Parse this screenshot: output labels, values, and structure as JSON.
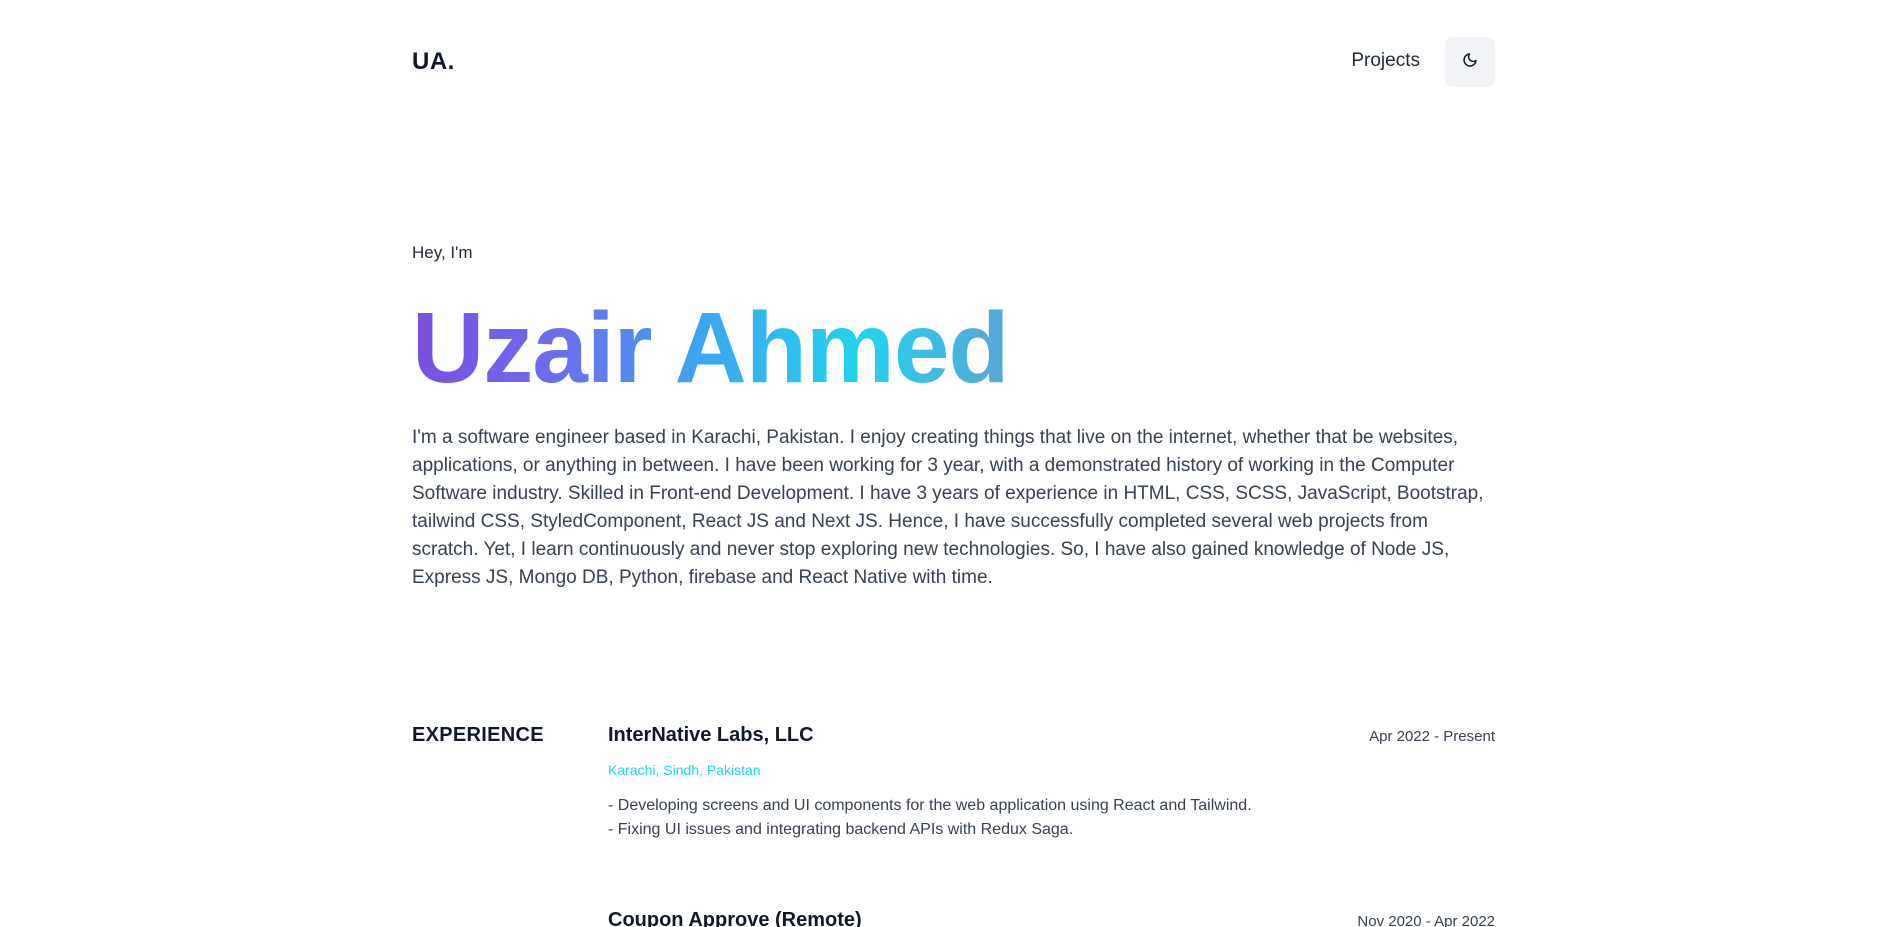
{
  "header": {
    "logo": "UA.",
    "nav_projects": "Projects",
    "theme_toggle_icon": "moon-icon"
  },
  "hero": {
    "greeting": "Hey, I'm",
    "name": "Uzair Ahmed",
    "name_gradient": [
      "#7c4ddf",
      "#6b6ef0",
      "#3aa8f0",
      "#22d3ee",
      "#5aa4d8"
    ],
    "bio": "I'm a software engineer based in Karachi, Pakistan. I enjoy creating things that live on the internet, whether that be websites, applications, or anything in between. I have been working for 3 year, with a demonstrated history of working in the Computer Software industry. Skilled in Front-end Development. I have 3 years of experience in HTML, CSS, SCSS, JavaScript, Bootstrap, tailwind CSS, StyledComponent, React JS and Next JS. Hence, I have successfully completed several web projects from scratch. Yet, I learn continuously and never stop exploring new technologies. So, I have also gained knowledge of Node JS, Express JS, Mongo DB, Python, firebase and React Native with time."
  },
  "experience": {
    "heading": "EXPERIENCE",
    "location_color": "#22d3ee",
    "jobs": [
      {
        "company": "InterNative Labs, LLC",
        "dates": "Apr 2022 - Present",
        "location": "Karachi, Sindh, Pakistan",
        "desc": [
          "- Developing screens and UI components for the web application using React and Tailwind.",
          "- Fixing UI issues and integrating backend APIs with Redux Saga."
        ]
      },
      {
        "company": "Coupon Approve (Remote)",
        "dates": "Nov 2020 - Apr 2022"
      }
    ]
  }
}
